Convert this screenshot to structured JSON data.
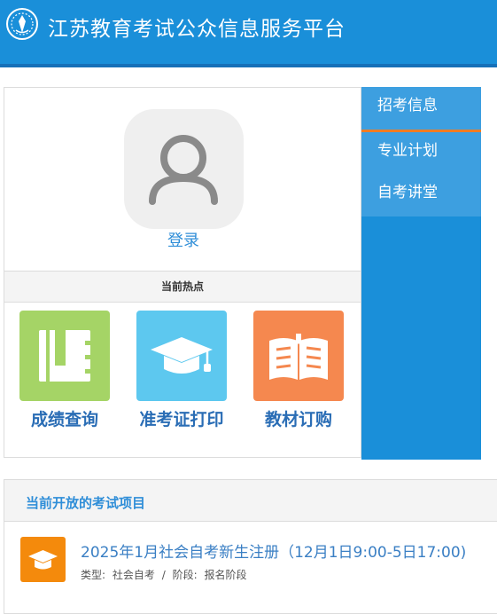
{
  "header": {
    "title": "江苏教育考试公众信息服务平台"
  },
  "user": {
    "login_label": "登录"
  },
  "hot": {
    "title": "当前热点",
    "tiles": [
      {
        "label": "成绩查询",
        "color": "#a5d466",
        "icon": "notebook-icon"
      },
      {
        "label": "准考证打印",
        "color": "#5dc8ef",
        "icon": "graduation-cap-icon"
      },
      {
        "label": "教材订购",
        "color": "#f5884f",
        "icon": "open-book-icon"
      }
    ]
  },
  "sidebar": {
    "items": [
      {
        "label": "招考信息"
      },
      {
        "label": "专业计划"
      },
      {
        "label": "自考讲堂"
      }
    ]
  },
  "open_exams": {
    "title": "当前开放的考试项目",
    "items": [
      {
        "title": "2025年1月社会自考新生注册（12月1日9:00-5日17:00)",
        "type_label": "类型:",
        "type_value": "社会自考",
        "separator": "/",
        "stage_label": "阶段:",
        "stage_value": "报名阶段"
      }
    ]
  },
  "colors": {
    "header_bg": "#1a8fd9",
    "accent_orange": "#f07c23",
    "link_blue": "#2f8ed8"
  }
}
